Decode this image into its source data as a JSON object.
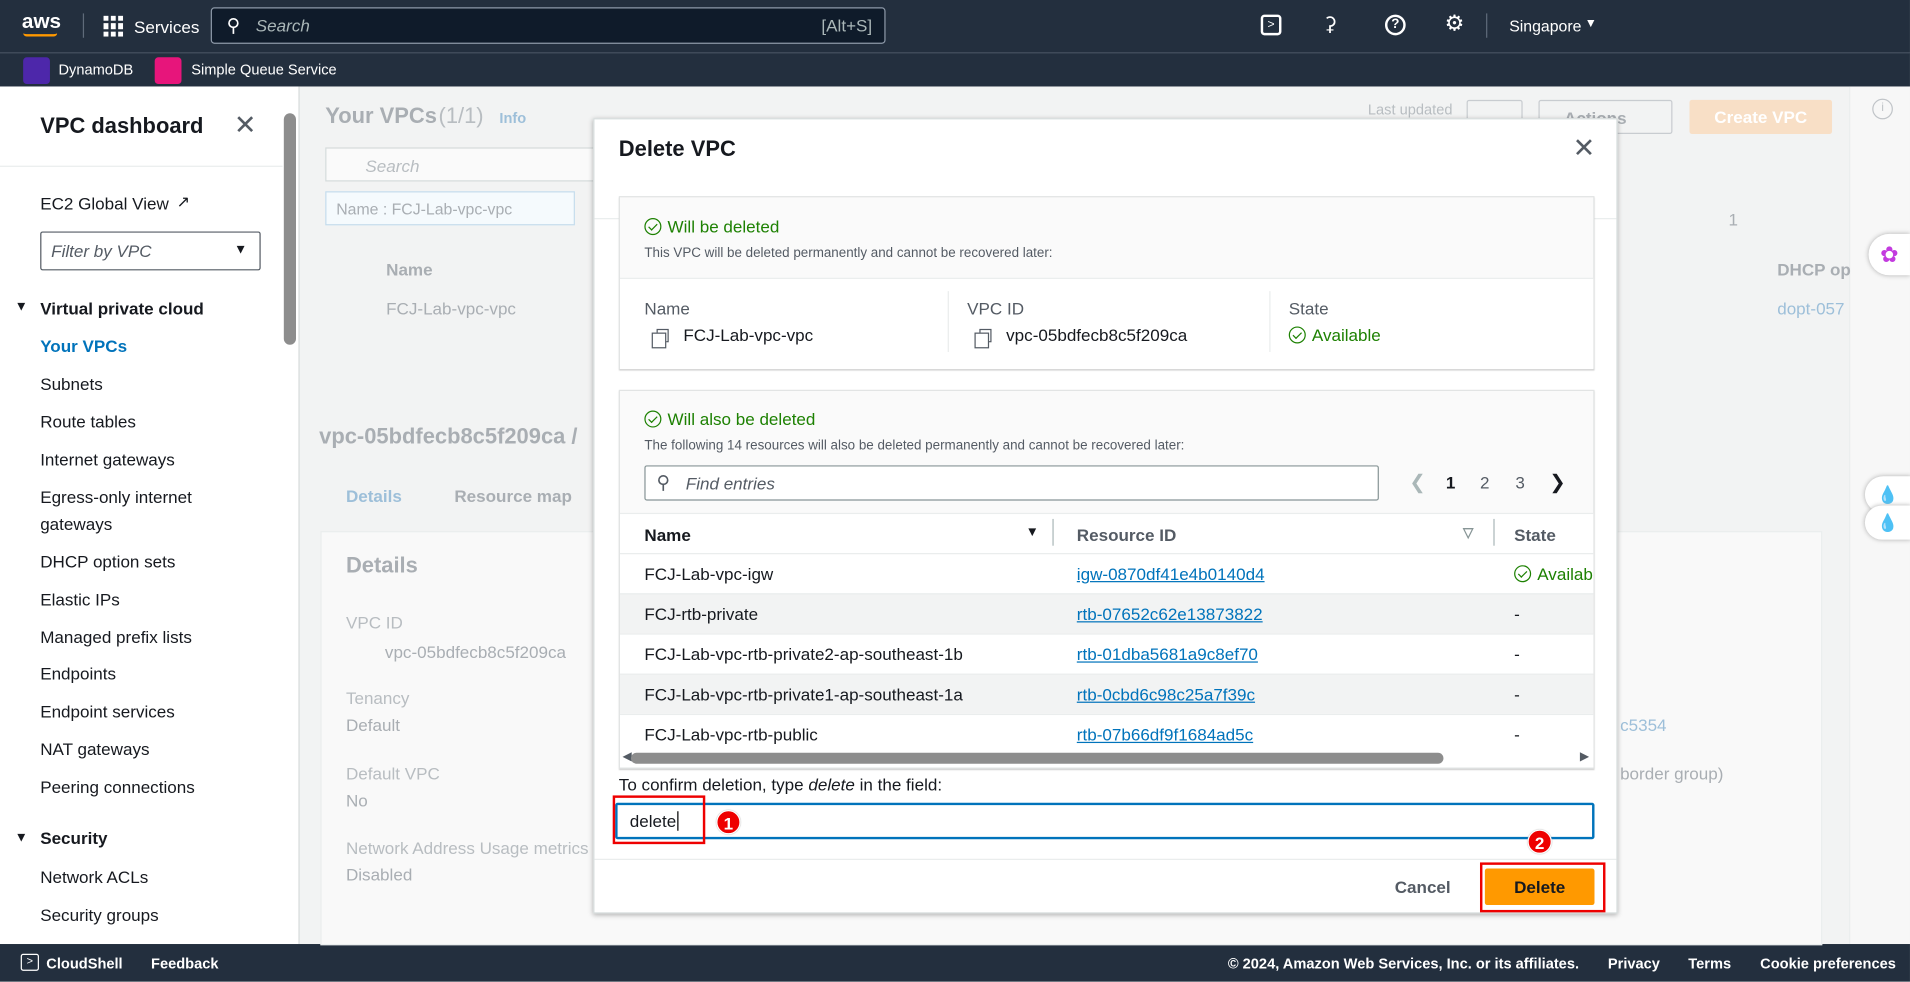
{
  "topbar": {
    "logo": "aws",
    "services": "Services",
    "search_placeholder": "Search",
    "search_shortcut": "[Alt+S]",
    "region": "Singapore"
  },
  "favorites": [
    {
      "label": "DynamoDB",
      "color": "#4d27aa"
    },
    {
      "label": "Simple Queue Service",
      "color": "#e7157b"
    }
  ],
  "sidebar": {
    "title": "VPC dashboard",
    "ec2_global_view": "EC2 Global View",
    "filter_placeholder": "Filter by VPC",
    "section1": "Virtual private cloud",
    "items": [
      "Your VPCs",
      "Subnets",
      "Route tables",
      "Internet gateways",
      "Egress-only internet",
      "gateways",
      "DHCP option sets",
      "Elastic IPs",
      "Managed prefix lists",
      "Endpoints",
      "Endpoint services",
      "NAT gateways",
      "Peering connections"
    ],
    "section2": "Security",
    "security_items": [
      "Network ACLs",
      "Security groups"
    ]
  },
  "background": {
    "title": "Your VPCs",
    "count": "(1/1)",
    "info": "Info",
    "last_updated": "Last updated",
    "actions": "Actions",
    "create": "Create VPC",
    "search": "Search",
    "filter_chip": "Name : FCJ-Lab-vpc-vpc",
    "col_name": "Name",
    "col_dhcp": "DHCP op",
    "row_name": "FCJ-Lab-vpc-vpc",
    "row_dhcp": "dopt-057",
    "page": "1",
    "detail_title": "vpc-05bdfecb8c5f209ca /",
    "tab_details": "Details",
    "tab_map": "Resource map",
    "details_heading": "Details",
    "vpc_id_label": "VPC ID",
    "vpc_id": "vpc-05bdfecb8c5f209ca",
    "tenancy_label": "Tenancy",
    "tenancy": "Default",
    "default_vpc_label": "Default VPC",
    "default_vpc": "No",
    "nau_label": "Network Address Usage metrics",
    "nau": "Disabled",
    "partial1": "c5354",
    "partial2": "border group)"
  },
  "modal": {
    "title": "Delete VPC",
    "box1": {
      "title": "Will be deleted",
      "subtitle": "This VPC will be deleted permanently and cannot be recovered later:",
      "name_label": "Name",
      "name": "FCJ-Lab-vpc-vpc",
      "vpcid_label": "VPC ID",
      "vpcid": "vpc-05bdfecb8c5f209ca",
      "state_label": "State",
      "state": "Available"
    },
    "box2": {
      "title": "Will also be deleted",
      "subtitle": "The following 14 resources will also be deleted permanently and cannot be recovered later:",
      "search_placeholder": "Find entries",
      "pages": [
        "1",
        "2",
        "3"
      ],
      "current_page": "1",
      "columns": [
        "Name",
        "Resource ID",
        "State"
      ],
      "rows": [
        {
          "name": "FCJ-Lab-vpc-igw",
          "id": "igw-0870df41e4b0140d4",
          "state": "Availab"
        },
        {
          "name": "FCJ-rtb-private",
          "id": "rtb-07652c62e13873822",
          "state": "-"
        },
        {
          "name": "FCJ-Lab-vpc-rtb-private2-ap-southeast-1b",
          "id": "rtb-01dba5681a9c8ef70",
          "state": "-"
        },
        {
          "name": "FCJ-Lab-vpc-rtb-private1-ap-southeast-1a",
          "id": "rtb-0cbd6c98c25a7f39c",
          "state": "-"
        },
        {
          "name": "FCJ-Lab-vpc-rtb-public",
          "id": "rtb-07b66df9f1684ad5c",
          "state": "-"
        }
      ]
    },
    "confirm_pre": "To confirm deletion, type ",
    "confirm_word": "delete",
    "confirm_post": " in the field:",
    "confirm_value": "delete",
    "cancel": "Cancel",
    "delete": "Delete",
    "step1": "1",
    "step2": "2"
  },
  "footer": {
    "cloudshell": "CloudShell",
    "feedback": "Feedback",
    "copyright": "© 2024, Amazon Web Services, Inc. or its affiliates.",
    "privacy": "Privacy",
    "terms": "Terms",
    "cookies": "Cookie preferences"
  },
  "colors": {
    "nav": "#232f3e",
    "primary": "#ec7211",
    "delete_button": "#ff9900",
    "success": "#1d8102",
    "link": "#0073bb",
    "annotation": "#e00000"
  }
}
